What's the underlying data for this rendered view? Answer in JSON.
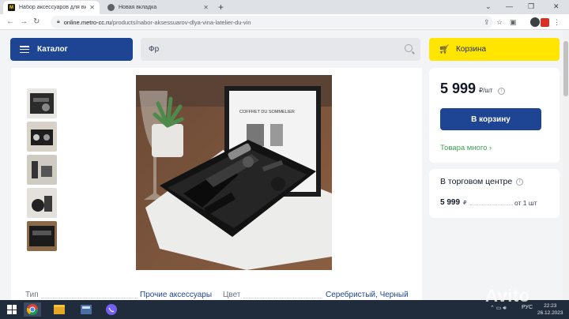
{
  "browser": {
    "tabs": [
      {
        "title": "Набор аксессуаров для вина L",
        "active": true,
        "favicon": "metro-m-icon"
      },
      {
        "title": "Новая вкладка",
        "active": false,
        "favicon": "chrome-icon"
      }
    ],
    "new_tab": "+",
    "url": {
      "host": "online.metro-cc.ru",
      "path": "/products/nabor-aksessuarov-dlya-vina-latelier-du-vin"
    }
  },
  "header": {
    "catalog_label": "Каталог",
    "search_value": "Фр",
    "cart_label": "Корзина"
  },
  "product": {
    "price": "5 999",
    "price_unit": "₽/шт",
    "buy_label": "В корзину",
    "stock_label": "Товара много",
    "specs": [
      {
        "label": "Тип",
        "value": "Прочие аксессуары"
      },
      {
        "label": "Цвет",
        "value": "Серебристый, Черный"
      }
    ],
    "box_text": "COFFRET DU SOMMELIER"
  },
  "store": {
    "title": "В торговом центре",
    "price": "5 999",
    "currency": "₽",
    "qty": "от 1 шт"
  },
  "taskbar": {
    "lang": "РУС",
    "time": "22:23",
    "date": "26.12.2023"
  },
  "watermark": "Avito",
  "colors": {
    "primary": "#1d4593",
    "cart_yellow": "#ffe500",
    "stock_green": "#3aa54f",
    "page_bg": "#f3f4f6"
  }
}
